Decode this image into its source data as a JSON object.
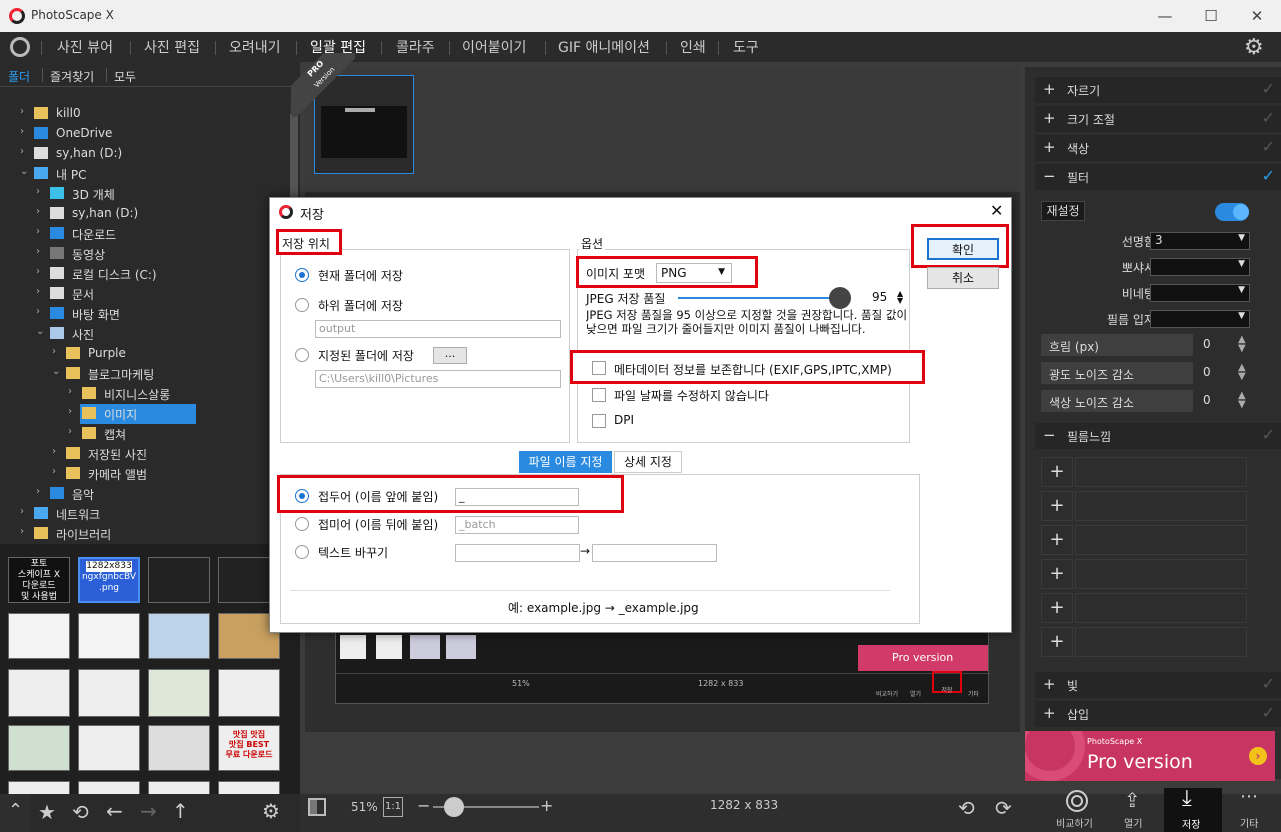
{
  "app": {
    "title": "PhotoScape X",
    "minimize": "—",
    "maximize": "☐",
    "close": "✕"
  },
  "menu": [
    "사진 뷰어",
    "사진 편집",
    "오려내기",
    "일괄 편집",
    "콜라주",
    "이어붙이기",
    "GIF 애니메이션",
    "인쇄",
    "도구"
  ],
  "left_tabs": [
    "폴더",
    "즐겨찾기",
    "모두"
  ],
  "tree": [
    {
      "label": "kill0",
      "indent": 0,
      "arrow": "›",
      "icon": "#e8c15a"
    },
    {
      "label": "OneDrive",
      "indent": 0,
      "arrow": "›",
      "icon": "#2a8ae0"
    },
    {
      "label": "sy,han (D:)",
      "indent": 0,
      "arrow": "›",
      "icon": "#ddd"
    },
    {
      "label": "내 PC",
      "indent": 0,
      "arrow": "⌄",
      "icon": "#4aa8f0"
    },
    {
      "label": "3D 개체",
      "indent": 1,
      "arrow": "›",
      "icon": "#3cc0e8"
    },
    {
      "label": "sy,han (D:)",
      "indent": 1,
      "arrow": "›",
      "icon": "#ddd"
    },
    {
      "label": "다운로드",
      "indent": 1,
      "arrow": "›",
      "icon": "#2a8ae0"
    },
    {
      "label": "동영상",
      "indent": 1,
      "arrow": "›",
      "icon": "#777"
    },
    {
      "label": "로컬 디스크 (C:)",
      "indent": 1,
      "arrow": "›",
      "icon": "#ddd"
    },
    {
      "label": "문서",
      "indent": 1,
      "arrow": "›",
      "icon": "#ddd"
    },
    {
      "label": "바탕 화면",
      "indent": 1,
      "arrow": "›",
      "icon": "#2a8ae0"
    },
    {
      "label": "사진",
      "indent": 1,
      "arrow": "⌄",
      "icon": "#aac8e8"
    },
    {
      "label": "Purple",
      "indent": 2,
      "arrow": "›",
      "icon": "#e8c15a"
    },
    {
      "label": "블로그마케팅",
      "indent": 2,
      "arrow": "⌄",
      "icon": "#e8c15a"
    },
    {
      "label": "비지니스살롱",
      "indent": 3,
      "arrow": "›",
      "icon": "#e8c15a"
    },
    {
      "label": "이미지",
      "indent": 3,
      "arrow": "›",
      "icon": "#e8c15a",
      "selected": true
    },
    {
      "label": "캡쳐",
      "indent": 3,
      "arrow": "›",
      "icon": "#e8c15a"
    },
    {
      "label": "저장된 사진",
      "indent": 2,
      "arrow": "›",
      "icon": "#e8c15a"
    },
    {
      "label": "카메라 앨범",
      "indent": 2,
      "arrow": "›",
      "icon": "#e8c15a"
    },
    {
      "label": "음악",
      "indent": 1,
      "arrow": "›",
      "icon": "#2a8ae0"
    },
    {
      "label": "네트워크",
      "indent": 0,
      "arrow": "›",
      "icon": "#4aa8f0"
    },
    {
      "label": "라이브러리",
      "indent": 0,
      "arrow": "›",
      "icon": "#e8c15a"
    }
  ],
  "thumbs": {
    "t1": [
      "포토",
      "스케이프 X",
      "다운로드",
      "및 사용법"
    ],
    "t2": [
      "1282x833",
      "ngxfgnbcBV",
      ".png"
    ],
    "t3": [
      "맛집 맛집",
      "맛집 BEST",
      "무료 다운로드"
    ]
  },
  "pro_badge": [
    "PRO",
    "Version"
  ],
  "dialog": {
    "title": "저장",
    "close": "✕",
    "save_location": {
      "label": "저장 위치",
      "opt_current": "현재 폴더에 저장",
      "opt_sub": "하위 폴더에 저장",
      "sub_value": "output",
      "opt_specified": "지정된 폴더에 저장",
      "browse": "...",
      "path_value": "C:\\Users\\kill0\\Pictures"
    },
    "options": {
      "label": "옵션",
      "format_label": "이미지 포맷",
      "format_value": "PNG",
      "jpeg_label": "JPEG 저장 품질",
      "jpeg_value": "95",
      "jpeg_quality": 95,
      "jpeg_note": "JPEG 저장 품질을 95 이상으로 지정할 것을 권장합니다. 품질 값이 낮으면 파일 크기가 줄어들지만 이미지 품질이 나빠집니다.",
      "metadata": "메타데이터 정보를 보존합니다 (EXIF,GPS,IPTC,XMP)",
      "keep_date": "파일 날짜를 수정하지 않습니다",
      "dpi": "DPI"
    },
    "confirm": "확인",
    "cancel": "취소",
    "tabs": [
      "파일 이름 지정",
      "상세 지정"
    ],
    "naming": {
      "prefix": "접두어 (이름 앞에 붙임)",
      "prefix_value": "_",
      "suffix": "접미어 (이름 뒤에 붙임)",
      "suffix_value": "_batch",
      "replace": "텍스트 바꾸기",
      "arrow": "→",
      "example": "예: example.jpg → _example.jpg"
    }
  },
  "right_panel": {
    "sections": [
      "자르기",
      "크기 조절",
      "색상",
      "필터"
    ],
    "reset": "재설정",
    "sharpness_label": "선명함",
    "sharpness_value": "3",
    "blur_label": "뽀샤시",
    "vignette_label": "비네팅",
    "grain_label": "필름 입자",
    "blur_px_label": "흐림 (px)",
    "blur_px_value": "0",
    "lum_noise_label": "광도 노이즈 감소",
    "lum_noise_value": "0",
    "color_noise_label": "색상 노이즈 감소",
    "color_noise_value": "0",
    "film_section": "필름느낌",
    "light_section": "빛",
    "insert_section": "삽입",
    "pro_small": "PhotoScape X",
    "pro_text": "Pro version"
  },
  "bottom": {
    "zoom": "51%",
    "ratio": "1:1",
    "size": "1282 x 833",
    "compare": "비교하기",
    "open": "열기",
    "save": "저장",
    "other": "기타",
    "zoom_fraction": 0.2
  },
  "inner_preview": {
    "zoom": "51%",
    "size": "1282 x 833",
    "pro_text": "Pro version",
    "labels": [
      "비교하기",
      "열기",
      "저장",
      "기타"
    ]
  }
}
